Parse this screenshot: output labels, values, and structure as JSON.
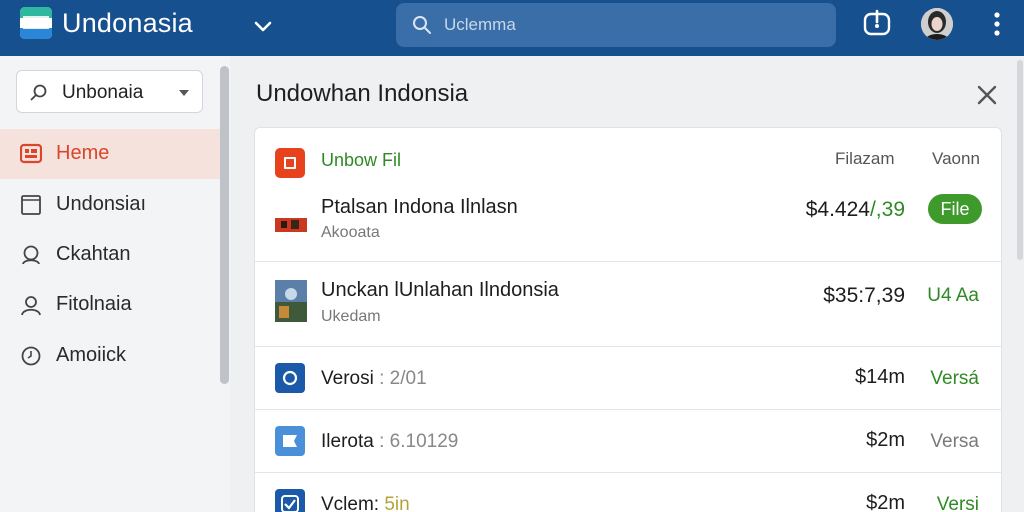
{
  "header": {
    "app_title": "Undonasia",
    "search_placeholder": "Uclemma",
    "icons": {
      "logo": "layers-logo-icon",
      "menu": "chevron-down-icon",
      "search": "search-icon",
      "power": "power-icon",
      "more": "kebab-icon"
    }
  },
  "sidebar": {
    "workspace_label": "Unbonaia",
    "items": [
      {
        "label": "Heme",
        "icon": "home-icon",
        "active": true
      },
      {
        "label": "Undonsiaı",
        "icon": "square-icon",
        "active": false
      },
      {
        "label": "Ckahtan",
        "icon": "chat-icon",
        "active": false
      },
      {
        "label": "Fitolnaia",
        "icon": "person-icon",
        "active": false
      },
      {
        "label": "Amoiick",
        "icon": "clock-icon",
        "active": false
      }
    ]
  },
  "main": {
    "title": "Undowhan Indonsia",
    "table_header": {
      "title": "Unbow Fil",
      "col1": "Filazam",
      "col2": "Vaonn"
    },
    "items": [
      {
        "title": "Ptalsan Indona Ilnlasn",
        "subtitle": "Akooata",
        "price_main": "$4.424",
        "price_accent": "/,39",
        "status": "File"
      },
      {
        "title": "Unckan lUnlahan Ilndonsia",
        "subtitle": "Ukedam",
        "price_main": "$35:7,39",
        "price_accent": "",
        "status": "U4 Aa"
      }
    ],
    "list": [
      {
        "label": "Verosi",
        "meta": ": 2/01",
        "amount": "$14m",
        "status": "Versá",
        "status_color": "green",
        "icon_color": "#1a5aa8"
      },
      {
        "label": "Ilerota",
        "meta": ": 6.10129",
        "amount": "$2m",
        "status": "Versa",
        "status_color": "grey",
        "icon_color": "#4a90d9"
      },
      {
        "label": "Vclem:",
        "meta": "5in",
        "amount": "$2m",
        "status": "Versi",
        "status_color": "green",
        "icon_color": "#1a5aa8"
      }
    ]
  }
}
